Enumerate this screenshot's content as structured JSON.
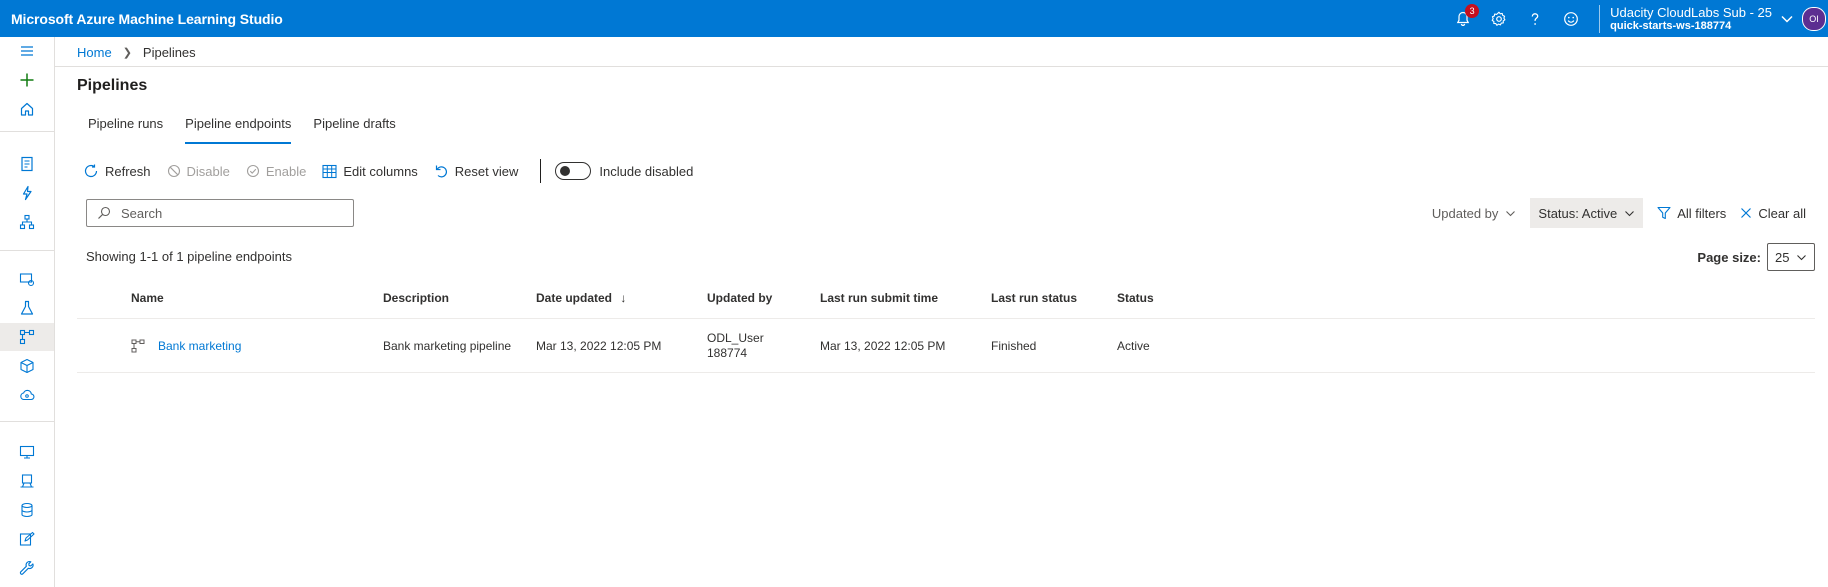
{
  "app": {
    "title": "Microsoft Azure Machine Learning Studio"
  },
  "topbar": {
    "notification_count": "3",
    "account_name": "Udacity CloudLabs Sub - 25",
    "workspace": "quick-starts-ws-188774",
    "avatar_initials": "OI"
  },
  "breadcrumb": {
    "home": "Home",
    "current": "Pipelines"
  },
  "page": {
    "title": "Pipelines"
  },
  "tabs": [
    {
      "label": "Pipeline runs"
    },
    {
      "label": "Pipeline endpoints"
    },
    {
      "label": "Pipeline drafts"
    }
  ],
  "toolbar": {
    "refresh": "Refresh",
    "disable": "Disable",
    "enable": "Enable",
    "edit_columns": "Edit columns",
    "reset_view": "Reset view",
    "include_disabled": "Include disabled"
  },
  "search": {
    "placeholder": "Search"
  },
  "filters": {
    "updated_by": "Updated by",
    "status": "Status: Active",
    "all_filters": "All filters",
    "clear_all": "Clear all"
  },
  "summary": {
    "showing": "Showing 1-1 of 1 pipeline endpoints"
  },
  "page_size": {
    "label": "Page size:",
    "value": "25"
  },
  "table": {
    "headers": {
      "name": "Name",
      "description": "Description",
      "date_updated": "Date updated",
      "sort_indicator": "↓",
      "updated_by": "Updated by",
      "last_run_submit_time": "Last run submit time",
      "last_run_status": "Last run status",
      "status": "Status"
    },
    "rows": [
      {
        "name": "Bank marketing",
        "description": "Bank marketing pipeline",
        "date_updated": "Mar 13, 2022 12:05 PM",
        "updated_by_line1": "ODL_User",
        "updated_by_line2": "188774",
        "last_run_submit_time": "Mar 13, 2022 12:05 PM",
        "last_run_status": "Finished",
        "status": "Active"
      }
    ]
  },
  "colors": {
    "brand": "#0078d4",
    "accent_green": "#107c10",
    "badge": "#c50f1f"
  }
}
